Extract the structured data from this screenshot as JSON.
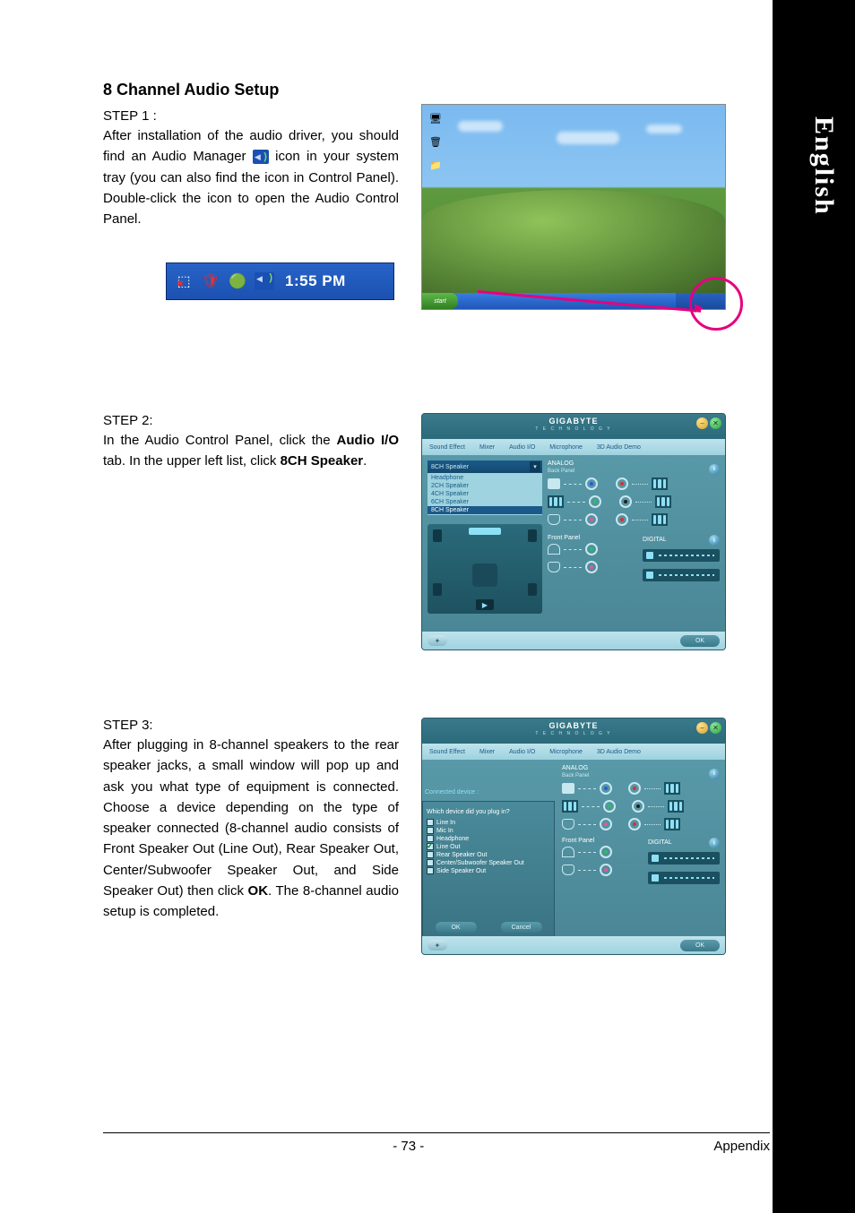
{
  "language_tab": "English",
  "title": "8 Channel Audio Setup",
  "step1": {
    "label": "STEP 1 :",
    "text_before_icon": "After installation of the audio driver, you should find an Audio Manager",
    "text_after_icon": "icon in your system tray (you can also find the icon in Control Panel).  Double-click the icon to open the Audio Control Panel."
  },
  "systray": {
    "time": "1:55 PM"
  },
  "desktop": {
    "start": "start"
  },
  "step2": {
    "label": "STEP 2:",
    "text_p1": "In the Audio Control Panel, click the ",
    "bold1": "Audio I/O",
    "text_p2": " tab. In the upper left list, click ",
    "bold2": "8CH Speaker",
    "text_p3": "."
  },
  "panel": {
    "brand": "GIGABYTE",
    "brand_sub": "T E C H N O L O G Y",
    "tabs": [
      "Sound Effect",
      "Mixer",
      "Audio I/O",
      "Microphone",
      "3D Audio Demo"
    ],
    "dropdown_value": "8CH Speaker",
    "dropdown_items": [
      "Headphone",
      "2CH Speaker",
      "4CH Speaker",
      "6CH Speaker",
      "8CH Speaker"
    ],
    "analog": "ANALOG",
    "back_panel": "Back Panel",
    "front_panel": "Front Panel",
    "digital": "DIGITAL",
    "ok": "OK",
    "info": "i"
  },
  "step3": {
    "label": "STEP 3:",
    "text_p1": "After plugging in 8-channel speakers to the rear speaker jacks, a small window will pop up and ask you what type of equipment is connected. Choose a device depending on the type of speaker connected (8-channel audio consists of Front Speaker Out (Line Out), Rear Speaker Out, Center/Subwoofer Speaker Out, and Side Speaker Out) then click ",
    "bold1": "OK",
    "text_p2": ". The 8-channel audio setup is completed."
  },
  "popup": {
    "title": "Connected device :",
    "question": "Which device did you plug in?",
    "options": [
      {
        "label": "Line In",
        "checked": false
      },
      {
        "label": "Mic In",
        "checked": false
      },
      {
        "label": "Headphone",
        "checked": false
      },
      {
        "label": "Line Out",
        "checked": true
      },
      {
        "label": "Rear Speaker Out",
        "checked": false
      },
      {
        "label": "Center/Subwoofer Speaker Out",
        "checked": false
      },
      {
        "label": "Side Speaker Out",
        "checked": false
      }
    ],
    "ok": "OK",
    "cancel": "Cancel"
  },
  "footer": {
    "page": "- 73 -",
    "section": "Appendix"
  }
}
